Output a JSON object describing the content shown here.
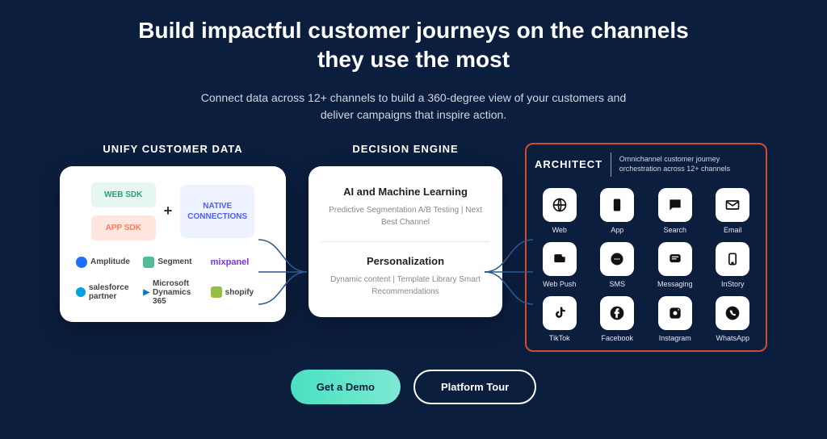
{
  "hero": {
    "title": "Build impactful customer journeys on the channels they use the most",
    "subtitle": "Connect data across 12+ channels to build a 360-degree view of your customers and deliver campaigns that inspire action."
  },
  "columns": {
    "unify": {
      "header": "UNIFY CUSTOMER DATA",
      "web_sdk": "WEB SDK",
      "app_sdk": "APP SDK",
      "plus": "+",
      "native": "NATIVE CONNECTIONS",
      "logos": [
        "Amplitude",
        "Segment",
        "mixpanel",
        "salesforce partner",
        "Microsoft Dynamics 365",
        "shopify"
      ]
    },
    "decision": {
      "header": "DECISION ENGINE",
      "s1_title": "AI and Machine Learning",
      "s1_body": "Predictive Segmentation\nA/B Testing | Next Best Channel",
      "s2_title": "Personalization",
      "s2_body": "Dynamic content | Template Library\nSmart Recommendations"
    },
    "architect": {
      "header": "ARCHITECT",
      "desc": "Omnichannel customer journey orchestration across 12+ channels",
      "channels": [
        "Web",
        "App",
        "Search",
        "Email",
        "Web Push",
        "SMS",
        "Messaging",
        "InStory",
        "TikTok",
        "Facebook",
        "Instagram",
        "WhatsApp"
      ]
    }
  },
  "cta": {
    "demo": "Get a Demo",
    "tour": "Platform Tour"
  }
}
